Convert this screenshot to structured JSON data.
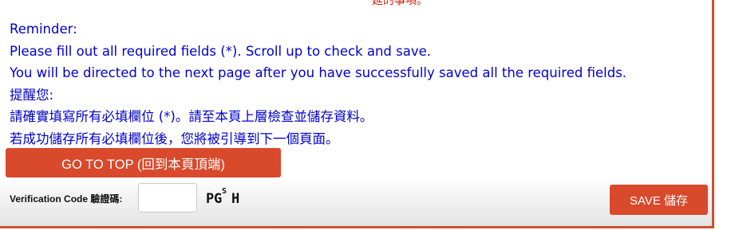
{
  "top_cut_text": "延的事項。",
  "reminder": {
    "lines": [
      "Reminder:",
      "Please fill out all required fields (*). Scroll up to check and save.",
      "You will be directed to the next page after you have successfully saved all the required fields.",
      "提醒您:",
      "請確實填寫所有必填欄位 (*)。請至本頁上層檢查並儲存資料。",
      "若成功儲存所有必填欄位後，您將被引導到下一個頁面。"
    ]
  },
  "go_top_button": "GO TO TOP (回到本頁頂端)",
  "verification": {
    "label": "Verification Code 驗證碼:",
    "input_value": "",
    "captcha_chars": [
      "P",
      "G",
      "S",
      "H"
    ]
  },
  "save_button": "SAVE 儲存",
  "colors": {
    "accent": "#d9492b",
    "reminder_text": "#0000cc",
    "border": "#cd5033"
  }
}
